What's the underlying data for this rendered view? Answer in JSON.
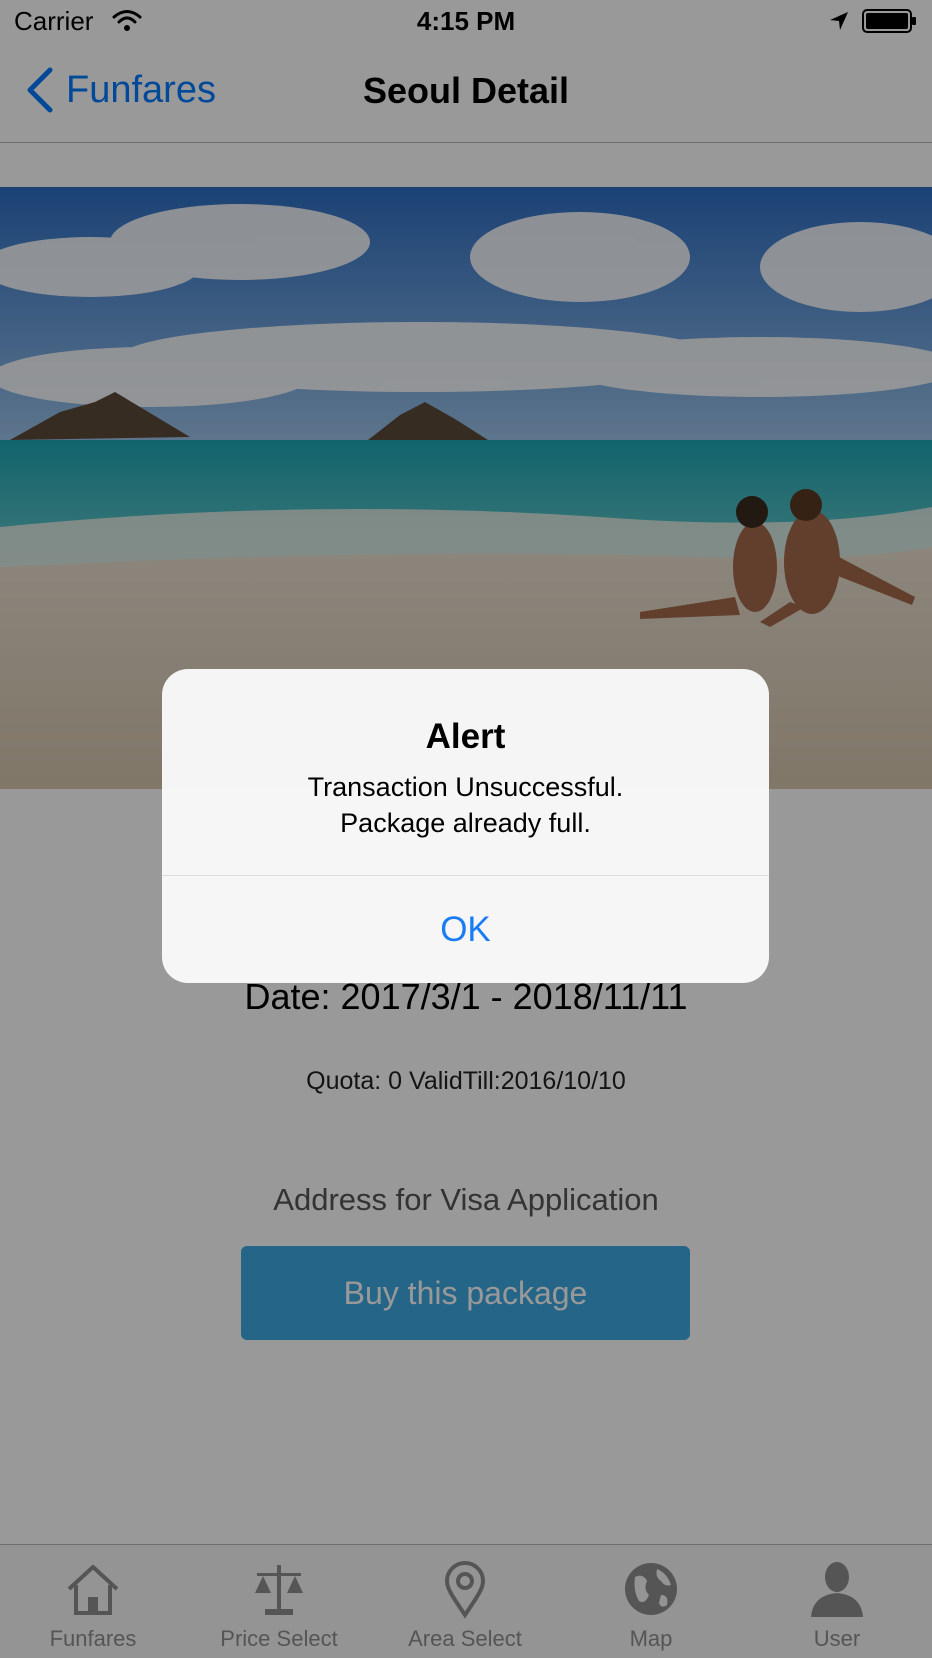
{
  "status_bar": {
    "carrier": "Carrier",
    "time": "4:15 PM",
    "icons": [
      "wifi-icon",
      "location-arrow-icon",
      "battery-icon"
    ]
  },
  "nav": {
    "back_label": "Funfares",
    "title": "Seoul Detail",
    "back_icon": "chevron-left-icon"
  },
  "hero": {
    "image": "beach-photo"
  },
  "details": {
    "date": "Date: 2017/3/1 - 2018/11/11",
    "quota": "Quota: 0 ValidTill:2016/10/10",
    "visa_label": "Address for Visa Application",
    "buy_button": "Buy this package"
  },
  "tabs": [
    {
      "label": "Funfares",
      "icon": "house-icon"
    },
    {
      "label": "Price Select",
      "icon": "scales-icon"
    },
    {
      "label": "Area Select",
      "icon": "map-pin-icon"
    },
    {
      "label": "Map",
      "icon": "globe-icon"
    },
    {
      "label": "User",
      "icon": "user-icon"
    }
  ],
  "alert": {
    "title": "Alert",
    "message_line1": "Transaction Unsuccessful.",
    "message_line2": "Package already full.",
    "ok_label": "OK"
  },
  "colors": {
    "accent": "#007aff",
    "alert_button": "#1a7cf5",
    "buy_button": "#3fa9e2",
    "tab_inactive": "#8e8e8e",
    "overlay": "rgba(0,0,0,0.4)"
  }
}
